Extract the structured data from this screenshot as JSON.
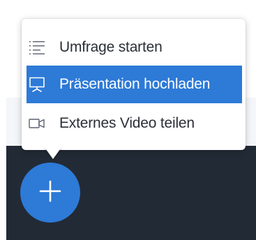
{
  "menu": {
    "items": [
      {
        "label": "Umfrage starten",
        "icon": "poll-list-icon",
        "active": false
      },
      {
        "label": "Präsentation hochladen",
        "icon": "presentation-icon",
        "active": true
      },
      {
        "label": "Externes Video teilen",
        "icon": "video-camera-icon",
        "active": false
      }
    ]
  },
  "fab": {
    "icon": "plus-icon"
  },
  "colors": {
    "accent": "#2d7ad7",
    "dark_background": "#222a35",
    "menu_text": "#2a2f36",
    "active_text": "#ffffff"
  }
}
